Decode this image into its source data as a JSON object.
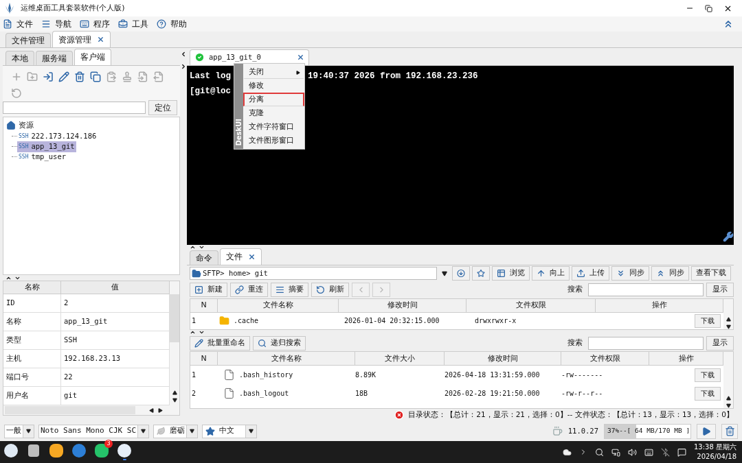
{
  "window": {
    "title": "运维桌面工具套装软件(个人版)"
  },
  "menu": [
    "文件",
    "导航",
    "程序",
    "工具",
    "帮助"
  ],
  "main_tabs": [
    {
      "label": "文件管理",
      "selected": false,
      "closable": false
    },
    {
      "label": "资源管理",
      "selected": true,
      "closable": true
    }
  ],
  "left_tabs": [
    {
      "label": "本地",
      "selected": false,
      "closable": false
    },
    {
      "label": "服务端",
      "selected": false,
      "closable": false
    },
    {
      "label": "客户端",
      "selected": true,
      "closable": false
    }
  ],
  "left_toolbar": [
    {
      "disabled": true
    },
    {
      "disabled": true
    },
    {
      "disabled": false
    },
    {
      "disabled": false
    },
    {
      "disabled": false
    },
    {
      "disabled": false
    },
    {
      "disabled": true
    },
    {
      "disabled": true
    },
    {
      "disabled": true
    },
    {
      "disabled": true
    },
    {
      "disabled": true
    }
  ],
  "locate_button": "定位",
  "tree": {
    "label": "资源",
    "children": [
      {
        "badge": "SSH",
        "label": "222.173.124.186",
        "selected": false
      },
      {
        "badge": "SSH",
        "label": "app_13_git",
        "selected": true
      },
      {
        "badge": "SSH",
        "label": "tmp_user",
        "selected": false
      }
    ]
  },
  "properties": {
    "columns": [
      "名称",
      "值"
    ],
    "rows": [
      [
        "ID",
        "2"
      ],
      [
        "名称",
        "app_13_git"
      ],
      [
        "类型",
        "SSH"
      ],
      [
        "主机",
        "192.168.23.13"
      ],
      [
        "端口号",
        "22"
      ],
      [
        "用户名",
        "git"
      ]
    ]
  },
  "terminal_tabs": [
    {
      "label": "app_13_git_0",
      "selected": true,
      "connected": true
    }
  ],
  "terminal": {
    "lines": [
      [
        "Last log",
        "19:40:37 2026 from 192.168.23.236"
      ],
      [
        "[git@loc"
      ]
    ]
  },
  "context_menu": {
    "side_label": "DeskUI",
    "items": [
      {
        "label": "关闭",
        "submenu": true,
        "highlighted": false,
        "separator_after": true
      },
      {
        "label": "修改",
        "submenu": false,
        "highlighted": false,
        "separator_after": false
      },
      {
        "label": "分离",
        "submenu": false,
        "highlighted": true,
        "separator_after": true
      },
      {
        "label": "克隆",
        "submenu": false,
        "highlighted": false,
        "separator_after": false
      },
      {
        "label": "文件字符窗口",
        "submenu": false,
        "highlighted": false,
        "separator_after": false
      },
      {
        "label": "文件图形窗口",
        "submenu": false,
        "highlighted": false,
        "separator_after": false
      }
    ]
  },
  "bottom_tabs": [
    {
      "label": "命令",
      "selected": false,
      "closable": false
    },
    {
      "label": "文件",
      "selected": true,
      "closable": true
    }
  ],
  "path": "SFTP> home> git",
  "path_buttons": [
    "浏览",
    "向上",
    "上传",
    "同步",
    "同步",
    "查看下载"
  ],
  "dir_toolbar": [
    "新建",
    "重连",
    "摘要",
    "刷新"
  ],
  "dir_search": {
    "label": "搜索",
    "button": "显示"
  },
  "dir_table": {
    "columns": [
      "N",
      "文件名称",
      "修改时间",
      "文件权限",
      "操作"
    ],
    "rows": [
      {
        "n": "1",
        "name": ".cache",
        "modified": "2026-01-04 20:32:15.000",
        "permissions": "drwxrwxr-x",
        "action": "下载"
      }
    ]
  },
  "file_toolbar": [
    "批量重命名",
    "递归搜索"
  ],
  "file_search": {
    "label": "搜索",
    "button": "显示"
  },
  "file_table": {
    "columns": [
      "N",
      "文件名称",
      "文件大小",
      "修改时间",
      "文件权限",
      "操作"
    ],
    "rows": [
      {
        "n": "1",
        "name": ".bash_history",
        "size": "8.89K",
        "modified": "2026-04-18 13:31:59.000",
        "permissions": "-rw-------",
        "action": "下载"
      },
      {
        "n": "2",
        "name": ".bash_logout",
        "size": "18B",
        "modified": "2026-02-28 19:21:50.000",
        "permissions": "-rw-r--r--",
        "action": "下载"
      }
    ]
  },
  "status": "目录状态：【总计：21，显示：21，选择：0】-- 文件状态：【总计：13，显示：13，选择：0】",
  "bottom_bar": {
    "combos": [
      "一般",
      "Noto Sans Mono CJK SC",
      "磨砺",
      "中文"
    ],
    "java_version": "11.0.27",
    "memory": {
      "text": "37%--[ 64 MB/170 MB ]",
      "level": 0.37
    }
  },
  "taskbar": {
    "apps": [
      {
        "active": false
      },
      {
        "active": false
      },
      {
        "active": false
      },
      {
        "active": false
      },
      {
        "active": false,
        "badge": "3"
      },
      {
        "active": true
      }
    ],
    "clock": {
      "time": "13:38 星期六",
      "date": "2026/04/18"
    }
  }
}
